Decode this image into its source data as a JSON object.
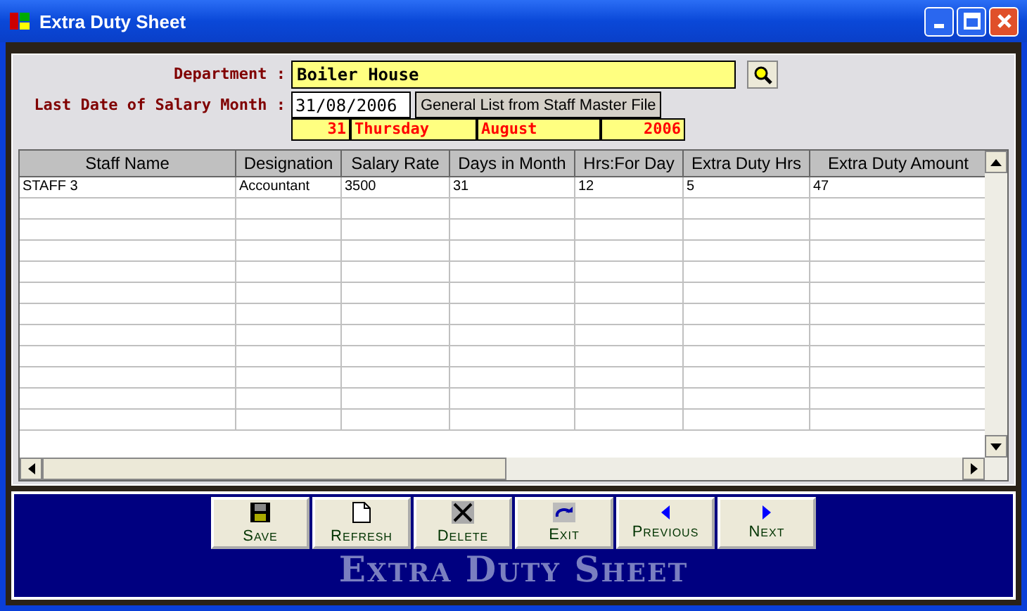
{
  "window": {
    "title": "Extra Duty Sheet"
  },
  "form": {
    "department_label": "Department :",
    "department": "Boiler House",
    "date_label": "Last Date of Salary Month :",
    "date": "31/08/2006",
    "general_list_button": "General List from Staff Master File",
    "day": "31",
    "weekday": "Thursday",
    "month": "August",
    "year": "2006"
  },
  "table": {
    "columns": [
      "Staff Name",
      "Designation",
      "Salary Rate",
      "Days in Month",
      "Hrs:For Day",
      "Extra Duty Hrs",
      "Extra Duty Amount"
    ],
    "rows": [
      [
        "STAFF 3",
        "Accountant",
        "3500",
        "31",
        "12",
        "5",
        "47"
      ]
    ]
  },
  "toolbar": [
    {
      "label": "Save",
      "kind": "save"
    },
    {
      "label": "Refresh",
      "kind": "refresh"
    },
    {
      "label": "Delete",
      "kind": "delete"
    },
    {
      "label": "Exit",
      "kind": "exit"
    },
    {
      "label": "Previous",
      "kind": "previous"
    },
    {
      "label": "Next",
      "kind": "next"
    }
  ],
  "banner": "Extra Duty Sheet"
}
